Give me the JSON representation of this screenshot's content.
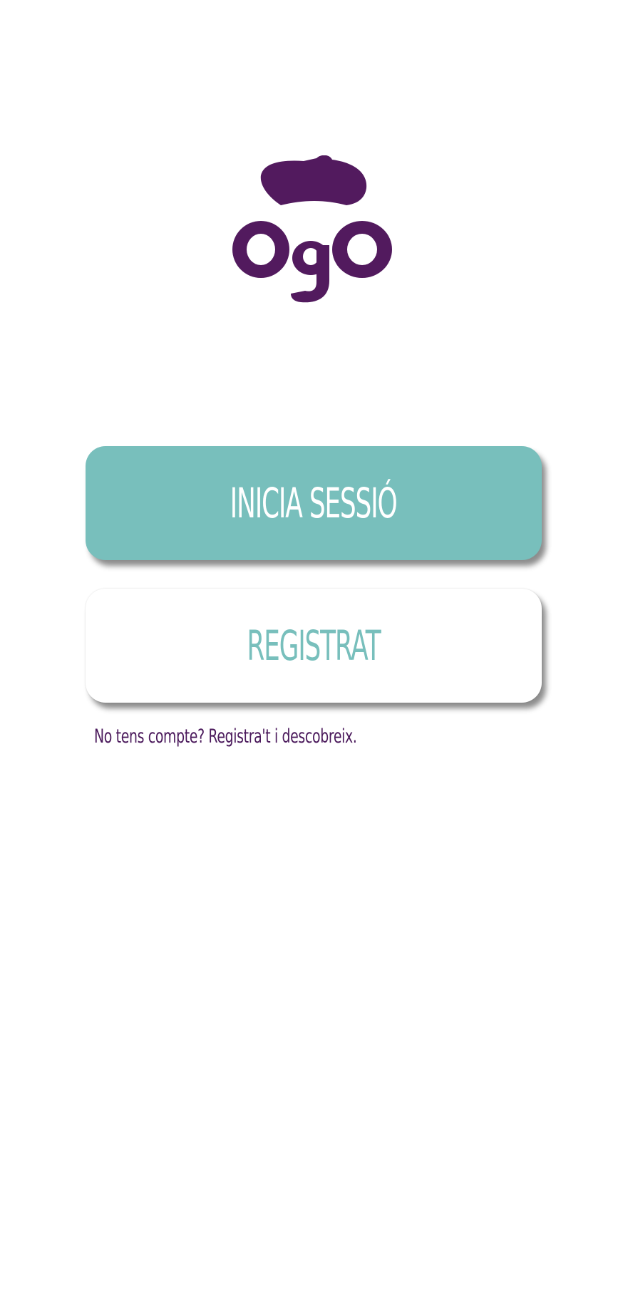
{
  "brand": {
    "logo_text": "ogo",
    "logo_icon": "beret-logo-icon",
    "primary_color": "#521a5e",
    "accent_color": "#78bfbc"
  },
  "actions": {
    "login_label": "INICIA SESSIÓ",
    "register_label": "REGISTRAT"
  },
  "hint_text": "No tens compte? Registra't i descobreix."
}
